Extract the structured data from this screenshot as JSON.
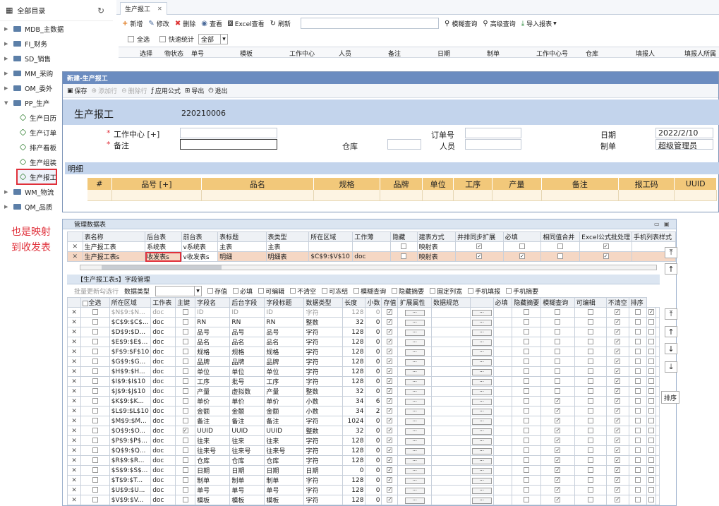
{
  "tree": {
    "title": "全部目录",
    "nodes": [
      "MDB_主数据",
      "FI_财务",
      "SD_销售",
      "MM_采购",
      "OM_委外",
      "PP_生产"
    ],
    "pp_children": [
      "生产日历",
      "生产订单",
      "排产看板",
      "生产组装",
      "生产报工"
    ],
    "after": [
      "WM_物流",
      "QM_品质"
    ]
  },
  "annotation": {
    "line1": "也是映射",
    "line2": "到收发表"
  },
  "tab": {
    "label": "生产报工",
    "close": "✕"
  },
  "toolbar": {
    "new": "新增",
    "edit": "修改",
    "delete": "删除",
    "view": "查看",
    "excel": "Excel查看",
    "refresh": "刷新",
    "fuzzy": "模糊查询",
    "advanced": "高级查询",
    "import": "导入报表"
  },
  "filters": {
    "select_all": "全选",
    "quick_stats": "快速统计",
    "scope": "全部"
  },
  "grid_cols": [
    "选择",
    "物状态",
    "单号",
    "模板",
    "工作中心",
    "人员",
    "备注",
    "日期",
    "制单",
    "工作中心号",
    "仓库",
    "填报人",
    "填报人所属"
  ],
  "dialog": {
    "title": "新建-生产报工",
    "save": "保存",
    "add_row": "添加行",
    "del_row": "删除行",
    "formula": "应用公式",
    "export": "导出",
    "exit": "退出",
    "form_title": "生产报工",
    "form_code": "220210006",
    "star": "*",
    "f_center": "工作中心 [+]",
    "f_note": "备注",
    "f_order": "订单号",
    "f_store": "仓库",
    "f_person": "人员",
    "f_date": "日期",
    "f_date_val": "2022/2/10",
    "f_maker": "制单",
    "f_maker_val": "超级管理员",
    "detail": "明细",
    "detail_cols": [
      "#",
      "品号 [+]",
      "品名",
      "规格",
      "品牌",
      "单位",
      "工序",
      "产量",
      "备注",
      "报工码",
      "UUID"
    ]
  },
  "mpanel": {
    "title": "管理数据表",
    "cols": [
      "表名称",
      "后台表",
      "前台表",
      "表标题",
      "表类型",
      "所在区域",
      "工作薄",
      "隐藏",
      "建表方式",
      "并排同步扩展",
      "必填",
      "相同值合并",
      "Excel公式批处理",
      "手机列表样式"
    ],
    "rows": [
      {
        "name": "生产报工表",
        "back": "系统表",
        "front": "v系统表",
        "title": "主表",
        "type": "主表",
        "area": "",
        "book": "",
        "hide": false,
        "mode": "映射表",
        "sync": true,
        "req": false,
        "merge": false,
        "excel": true
      },
      {
        "name": "生产报工表s",
        "back": "收发表s",
        "front": "v收发表s",
        "title": "明细",
        "type": "明细表",
        "area": "$C$9:$V$10",
        "book": "doc",
        "hide": false,
        "mode": "映射表",
        "sync": true,
        "req": true,
        "merge": false,
        "excel": true
      }
    ]
  },
  "fields": {
    "title": "【生产报工表s】字段管理",
    "batch": "批量更新勾选行",
    "dtype": "数据类型",
    "opts": [
      "存值",
      "必填",
      "可编辑",
      "不清空",
      "可冻结",
      "模糊查询",
      "隐藏摘要",
      "固定列宽",
      "手机填报",
      "手机摘要"
    ],
    "cols": [
      "全选",
      "所在区域",
      "工作表",
      "主键",
      "字段名",
      "后台字段",
      "字段标题",
      "数据类型",
      "长度",
      "小数",
      "存值",
      "扩展属性",
      "数据规范",
      "",
      "必填",
      "隐藏摘要",
      "模糊查询",
      "可编辑",
      "不清空",
      "排序"
    ],
    "rows": [
      [
        "$N$9:$N...",
        "doc",
        "",
        "ID",
        "ID",
        "ID",
        "字符",
        "128",
        "0",
        true,
        false,
        false,
        false,
        true,
        false,
        true
      ],
      [
        "$C$9:$C$...",
        "doc",
        "",
        "RN",
        "RN",
        "RN",
        "整数",
        "32",
        "0",
        true,
        false,
        false,
        false,
        true,
        false,
        false
      ],
      [
        "$D$9:$D...",
        "doc",
        "",
        "品号",
        "品号",
        "品号",
        "字符",
        "128",
        "0",
        true,
        false,
        false,
        false,
        true,
        false,
        false
      ],
      [
        "$E$9:$E$...",
        "doc",
        "",
        "品名",
        "品名",
        "品名",
        "字符",
        "128",
        "0",
        true,
        false,
        false,
        false,
        true,
        false,
        false
      ],
      [
        "$F$9:$F$10",
        "doc",
        "",
        "规格",
        "规格",
        "规格",
        "字符",
        "128",
        "0",
        true,
        false,
        false,
        false,
        true,
        false,
        false
      ],
      [
        "$G$9:$G...",
        "doc",
        "",
        "品牌",
        "品牌",
        "品牌",
        "字符",
        "128",
        "0",
        true,
        false,
        false,
        false,
        true,
        false,
        false
      ],
      [
        "$H$9:$H...",
        "doc",
        "",
        "单位",
        "单位",
        "单位",
        "字符",
        "128",
        "0",
        true,
        false,
        false,
        false,
        true,
        false,
        false
      ],
      [
        "$I$9:$I$10",
        "doc",
        "",
        "工序",
        "批号",
        "工序",
        "字符",
        "128",
        "0",
        true,
        false,
        false,
        false,
        true,
        false,
        false
      ],
      [
        "$J$9:$J$10",
        "doc",
        "",
        "产量",
        "虚拟数",
        "产量",
        "整数",
        "32",
        "0",
        true,
        false,
        false,
        false,
        true,
        false,
        false
      ],
      [
        "$K$9:$K...",
        "doc",
        "",
        "单价",
        "单价",
        "单价",
        "小数",
        "34",
        "6",
        true,
        false,
        true,
        false,
        true,
        false,
        false
      ],
      [
        "$L$9:$L$10",
        "doc",
        "",
        "金额",
        "金额",
        "金额",
        "小数",
        "34",
        "2",
        true,
        false,
        true,
        false,
        true,
        false,
        false
      ],
      [
        "$M$9:$M...",
        "doc",
        "",
        "备注",
        "备注",
        "备注",
        "字符",
        "1024",
        "0",
        true,
        false,
        true,
        false,
        true,
        false,
        false
      ],
      [
        "$O$9:$O...",
        "doc",
        "✓",
        "UUID",
        "UUID",
        "UUID",
        "整数",
        "32",
        "0",
        true,
        false,
        true,
        false,
        true,
        false,
        false
      ],
      [
        "$P$9:$P$...",
        "doc",
        "",
        "往来",
        "往来",
        "往来",
        "字符",
        "128",
        "0",
        true,
        false,
        true,
        false,
        true,
        false,
        false
      ],
      [
        "$Q$9:$Q...",
        "doc",
        "",
        "往来号",
        "往来号",
        "往来号",
        "字符",
        "128",
        "0",
        true,
        false,
        true,
        false,
        true,
        false,
        false
      ],
      [
        "$R$9:$R...",
        "doc",
        "",
        "仓库",
        "仓库",
        "仓库",
        "字符",
        "128",
        "0",
        true,
        false,
        true,
        false,
        true,
        false,
        false
      ],
      [
        "$S$9:$S$...",
        "doc",
        "",
        "日期",
        "日期",
        "日期",
        "日期",
        "0",
        "0",
        true,
        false,
        true,
        false,
        true,
        false,
        false
      ],
      [
        "$T$9:$T...",
        "doc",
        "",
        "制单",
        "制单",
        "制单",
        "字符",
        "128",
        "0",
        true,
        false,
        true,
        false,
        true,
        false,
        false
      ],
      [
        "$U$9:$U...",
        "doc",
        "",
        "单号",
        "单号",
        "单号",
        "字符",
        "128",
        "0",
        true,
        false,
        true,
        false,
        true,
        false,
        false
      ],
      [
        "$V$9:$V...",
        "doc",
        "",
        "模板",
        "模板",
        "模板",
        "字符",
        "128",
        "0",
        true,
        false,
        true,
        false,
        true,
        false,
        false
      ]
    ]
  },
  "sort_label": "排序"
}
